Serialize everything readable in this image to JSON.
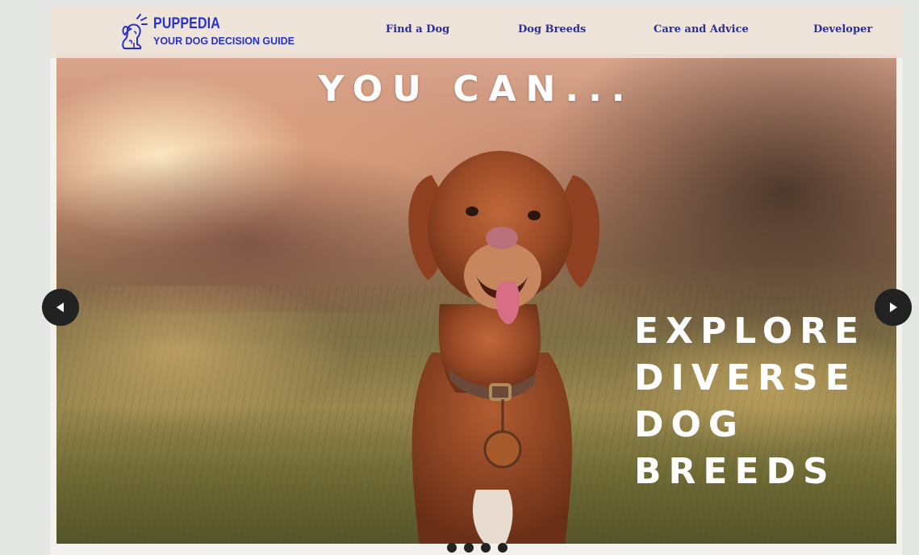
{
  "brand": {
    "name": "PUPPEDIA",
    "tagline": "YOUR DOG DECISION GUIDE",
    "logo_icon": "dog-logo-icon",
    "color": "#2631c9"
  },
  "nav": {
    "items": [
      {
        "label": "Find a Dog"
      },
      {
        "label": "Dog Breeds"
      },
      {
        "label": "Care and Advice"
      },
      {
        "label": "Developer"
      }
    ],
    "color": "#2a2f9c"
  },
  "slideshow": {
    "heading": "YOU CAN...",
    "caption_lines": [
      "EXPLORE",
      "DIVERSE",
      "DOG",
      "BREEDS"
    ],
    "prev_icon": "chevron-left-icon",
    "next_icon": "chevron-right-icon",
    "dot_count": 4,
    "image_subject": "dog-photo"
  }
}
